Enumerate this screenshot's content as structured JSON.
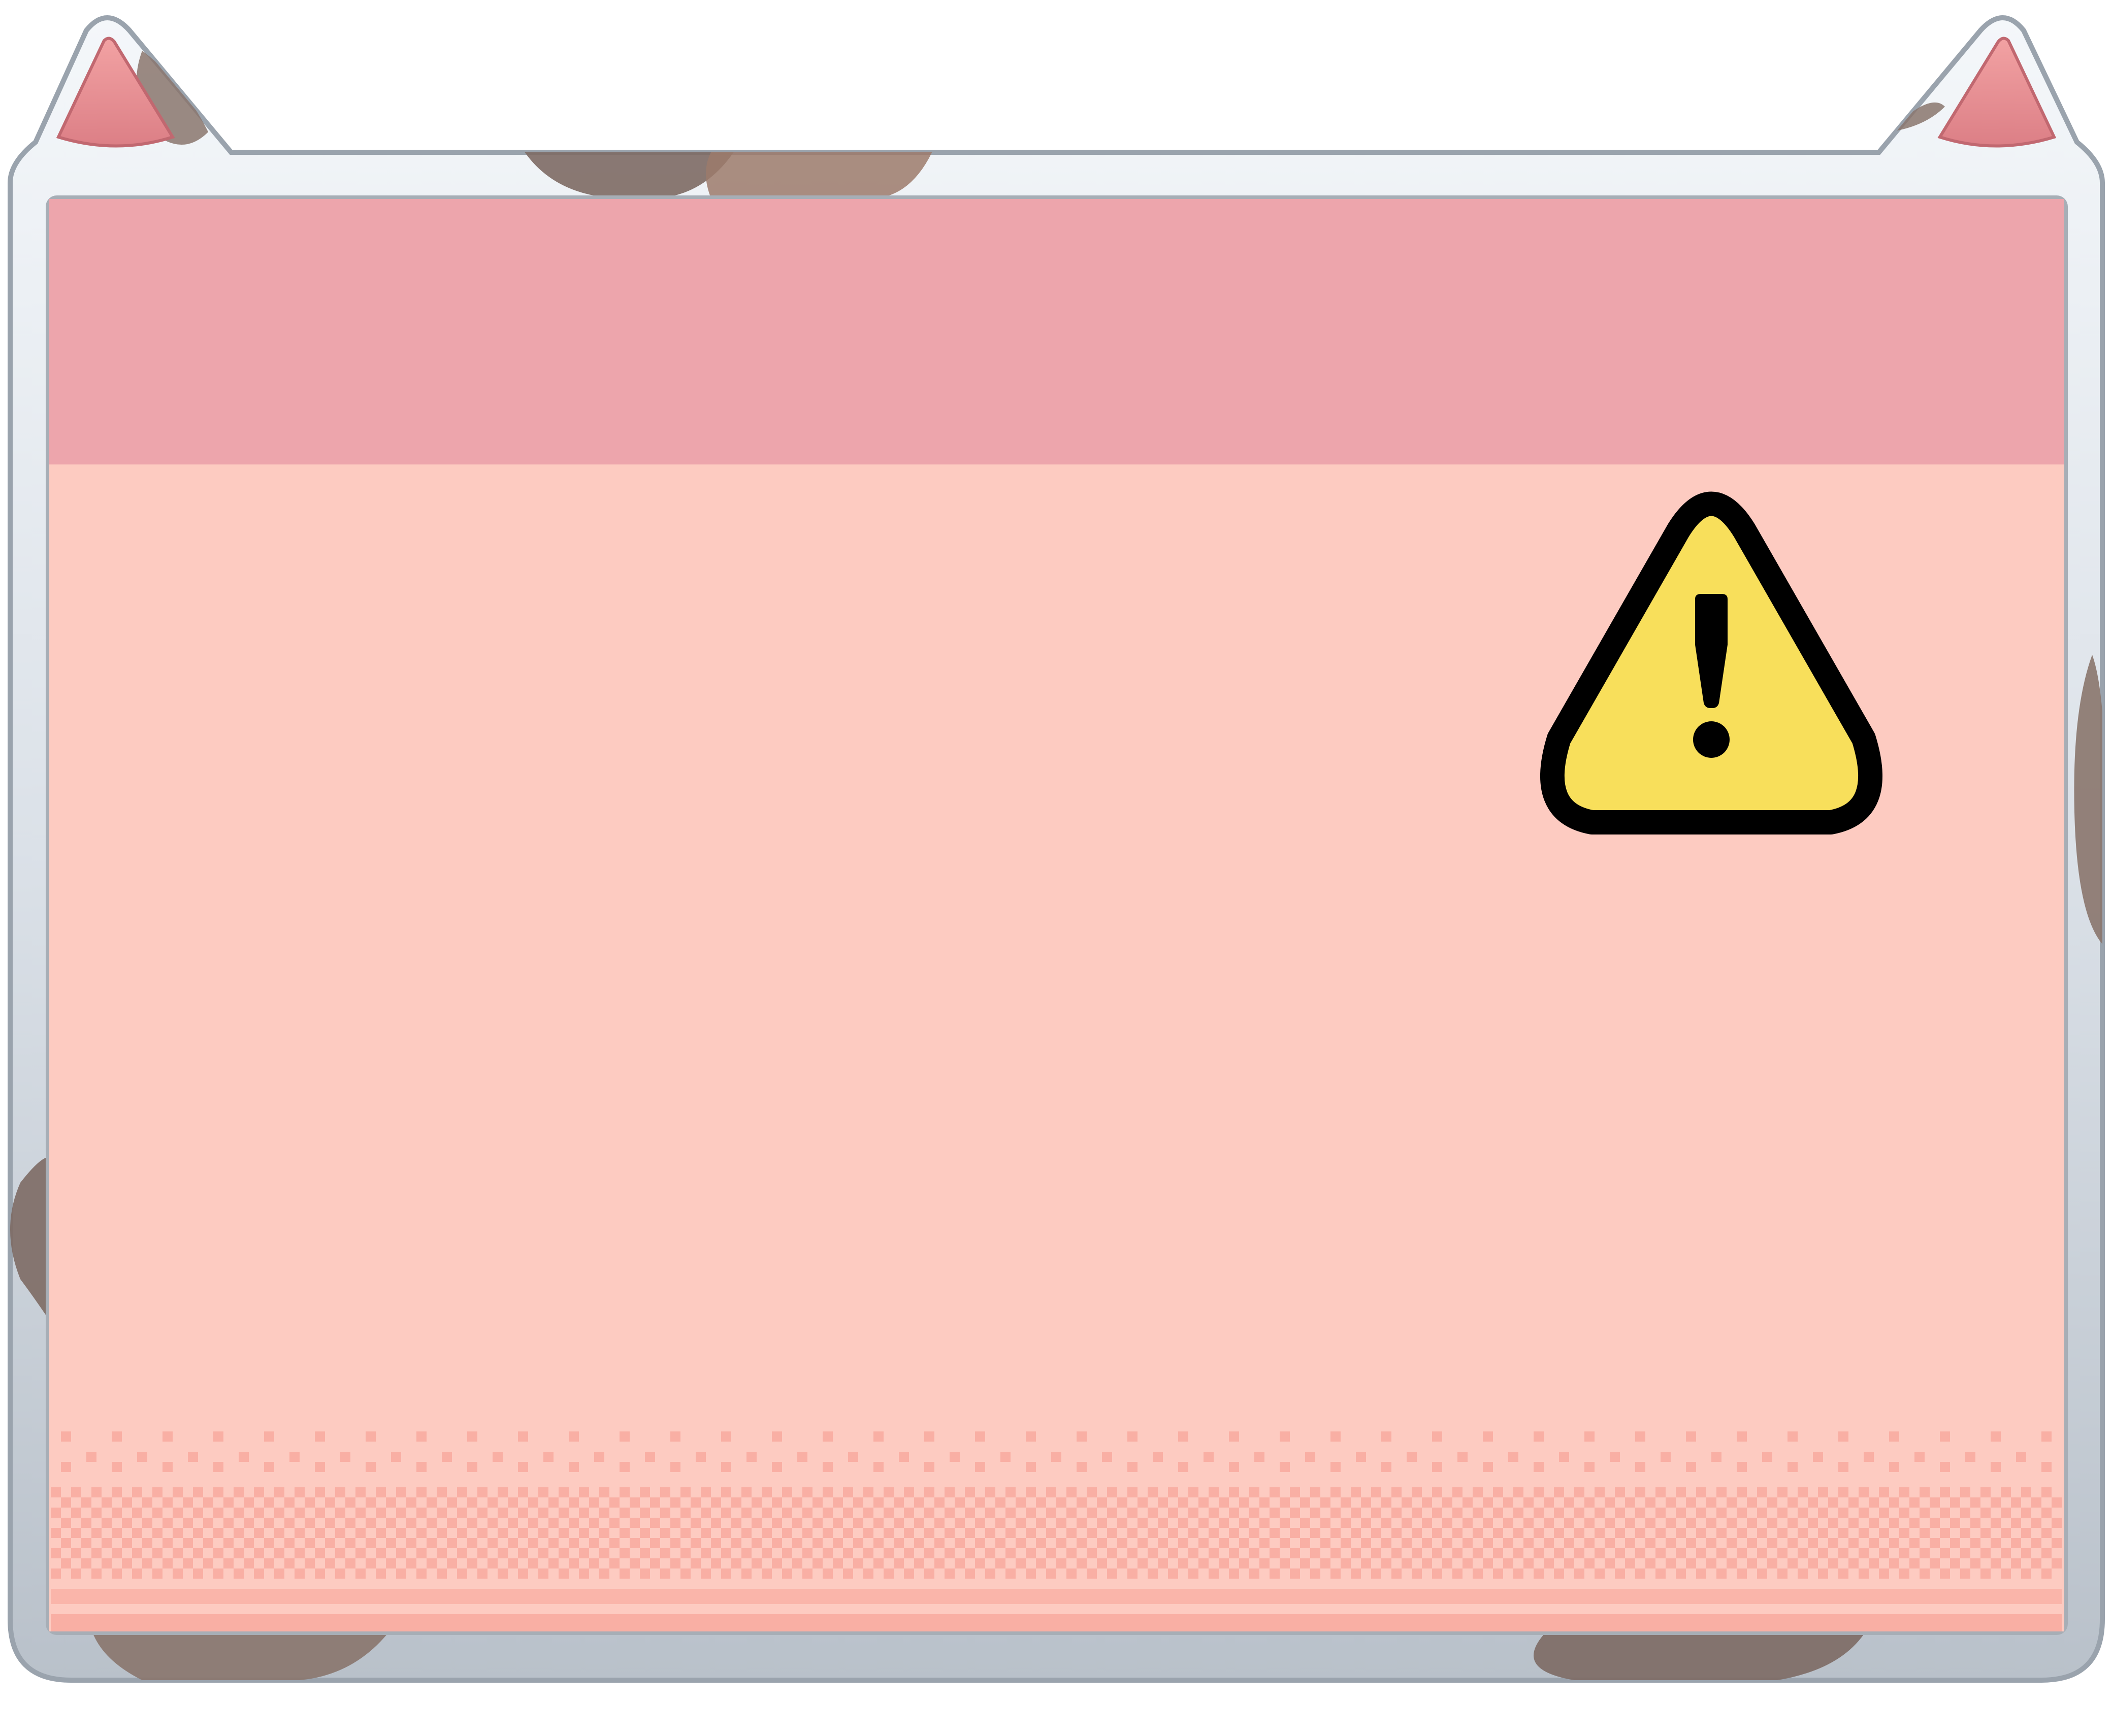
{
  "dialog": {
    "type": "warning",
    "title": "",
    "message": "",
    "icon": "warning-triangle-icon"
  },
  "colors": {
    "frame": "#dde3ea",
    "frame_shadow": "#9aa3ad",
    "spots": "#8a756d",
    "ear_inner": "#e88f93",
    "title_bar": "#eda5ac",
    "body": "#fdcbc1",
    "dither": "#f9afa4",
    "warning_fill": "#f8df5b",
    "warning_stroke": "#000000"
  }
}
